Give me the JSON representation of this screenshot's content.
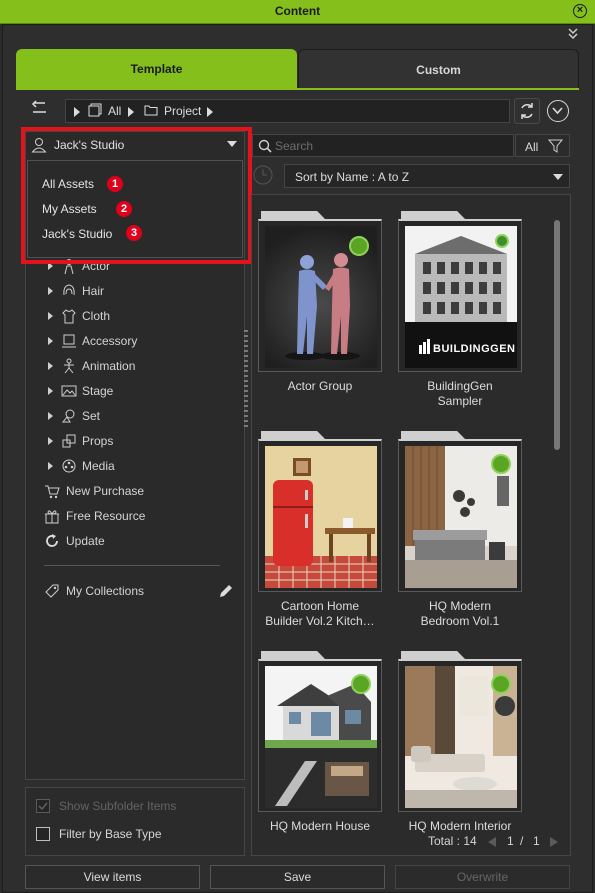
{
  "window": {
    "title": "Content"
  },
  "tabs": [
    {
      "label": "Template",
      "active": true
    },
    {
      "label": "Custom",
      "active": false
    }
  ],
  "path": [
    "All",
    "Project"
  ],
  "studio_select": {
    "value": "Jack's Studio"
  },
  "dropdown_items": [
    {
      "label": "All Assets",
      "badge": "1"
    },
    {
      "label": "My Assets",
      "badge": "2"
    },
    {
      "label": "Jack's Studio",
      "badge": "3"
    }
  ],
  "tree": [
    {
      "label": "Actor",
      "icon": "actor-icon"
    },
    {
      "label": "Hair",
      "icon": "hair-icon"
    },
    {
      "label": "Cloth",
      "icon": "cloth-icon"
    },
    {
      "label": "Accessory",
      "icon": "accessory-icon"
    },
    {
      "label": "Animation",
      "icon": "animation-icon"
    },
    {
      "label": "Stage",
      "icon": "stage-icon"
    },
    {
      "label": "Set",
      "icon": "set-icon"
    },
    {
      "label": "Props",
      "icon": "props-icon"
    },
    {
      "label": "Media",
      "icon": "media-icon"
    }
  ],
  "extras": [
    {
      "label": "New Purchase",
      "icon": "cart-icon"
    },
    {
      "label": "Free Resource",
      "icon": "gift-icon"
    },
    {
      "label": "Update",
      "icon": "refresh-icon"
    }
  ],
  "collections": {
    "label": "My Collections"
  },
  "options": {
    "show_subfolder": {
      "label": "Show Subfolder Items",
      "checked": true,
      "enabled": false
    },
    "filter_base": {
      "label": "Filter by Base Type",
      "checked": false,
      "enabled": true
    }
  },
  "search": {
    "placeholder": "Search"
  },
  "filter": {
    "label": "All"
  },
  "sort": {
    "value": "Sort by Name : A to Z"
  },
  "items": [
    {
      "line1": "Actor Group",
      "line2": ""
    },
    {
      "line1": "BuildingGen",
      "line2": "Sampler",
      "logo": "BUILDINGGEN"
    },
    {
      "line1": "Cartoon Home",
      "line2": "Builder Vol.2 Kitch…"
    },
    {
      "line1": "HQ Modern",
      "line2": "Bedroom Vol.1"
    },
    {
      "line1": "HQ Modern House",
      "line2": ""
    },
    {
      "line1": "HQ Modern Interior",
      "line2": ""
    }
  ],
  "footer": {
    "total": "Total : 14",
    "page": "1",
    "sep": "/",
    "pages": "1"
  },
  "buttons": {
    "view": "View items",
    "save": "Save",
    "overwrite": "Overwrite"
  }
}
